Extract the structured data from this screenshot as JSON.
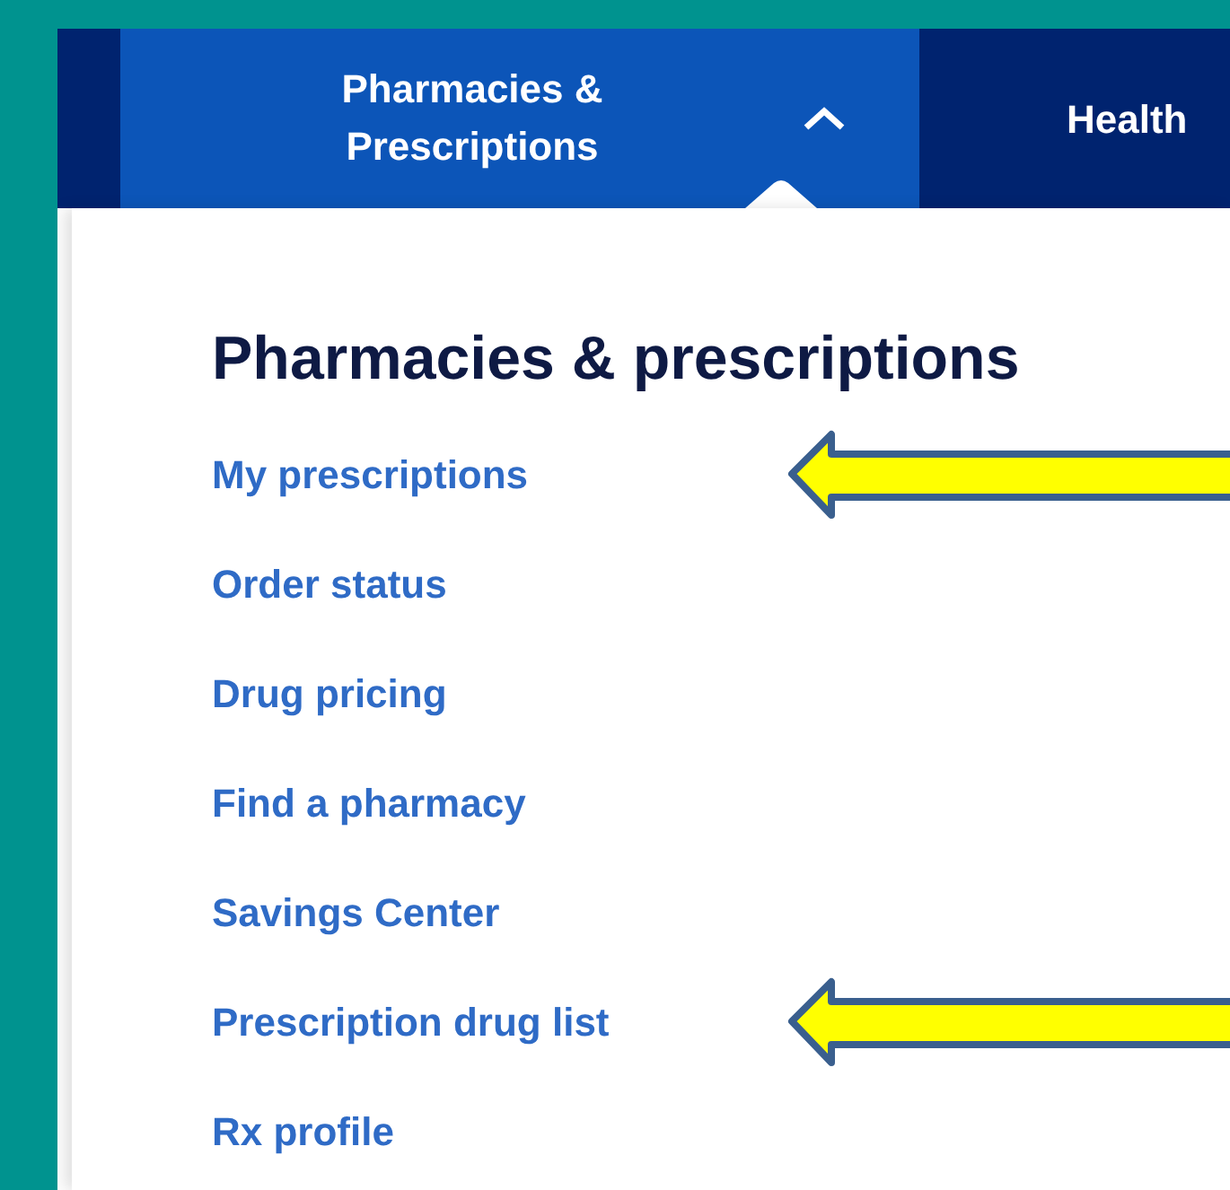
{
  "nav": {
    "tabs": [
      {
        "label": "Pharmacies & Prescriptions",
        "selected": true
      },
      {
        "label": "Health",
        "selected": false
      }
    ]
  },
  "dropdown": {
    "heading": "Pharmacies & prescriptions",
    "links": [
      {
        "label": "My prescriptions",
        "highlighted": true
      },
      {
        "label": "Order status",
        "highlighted": false
      },
      {
        "label": "Drug pricing",
        "highlighted": false
      },
      {
        "label": "Find a pharmacy",
        "highlighted": false
      },
      {
        "label": "Savings Center",
        "highlighted": false
      },
      {
        "label": "Prescription drug list",
        "highlighted": true
      },
      {
        "label": "Rx profile",
        "highlighted": false
      }
    ]
  }
}
